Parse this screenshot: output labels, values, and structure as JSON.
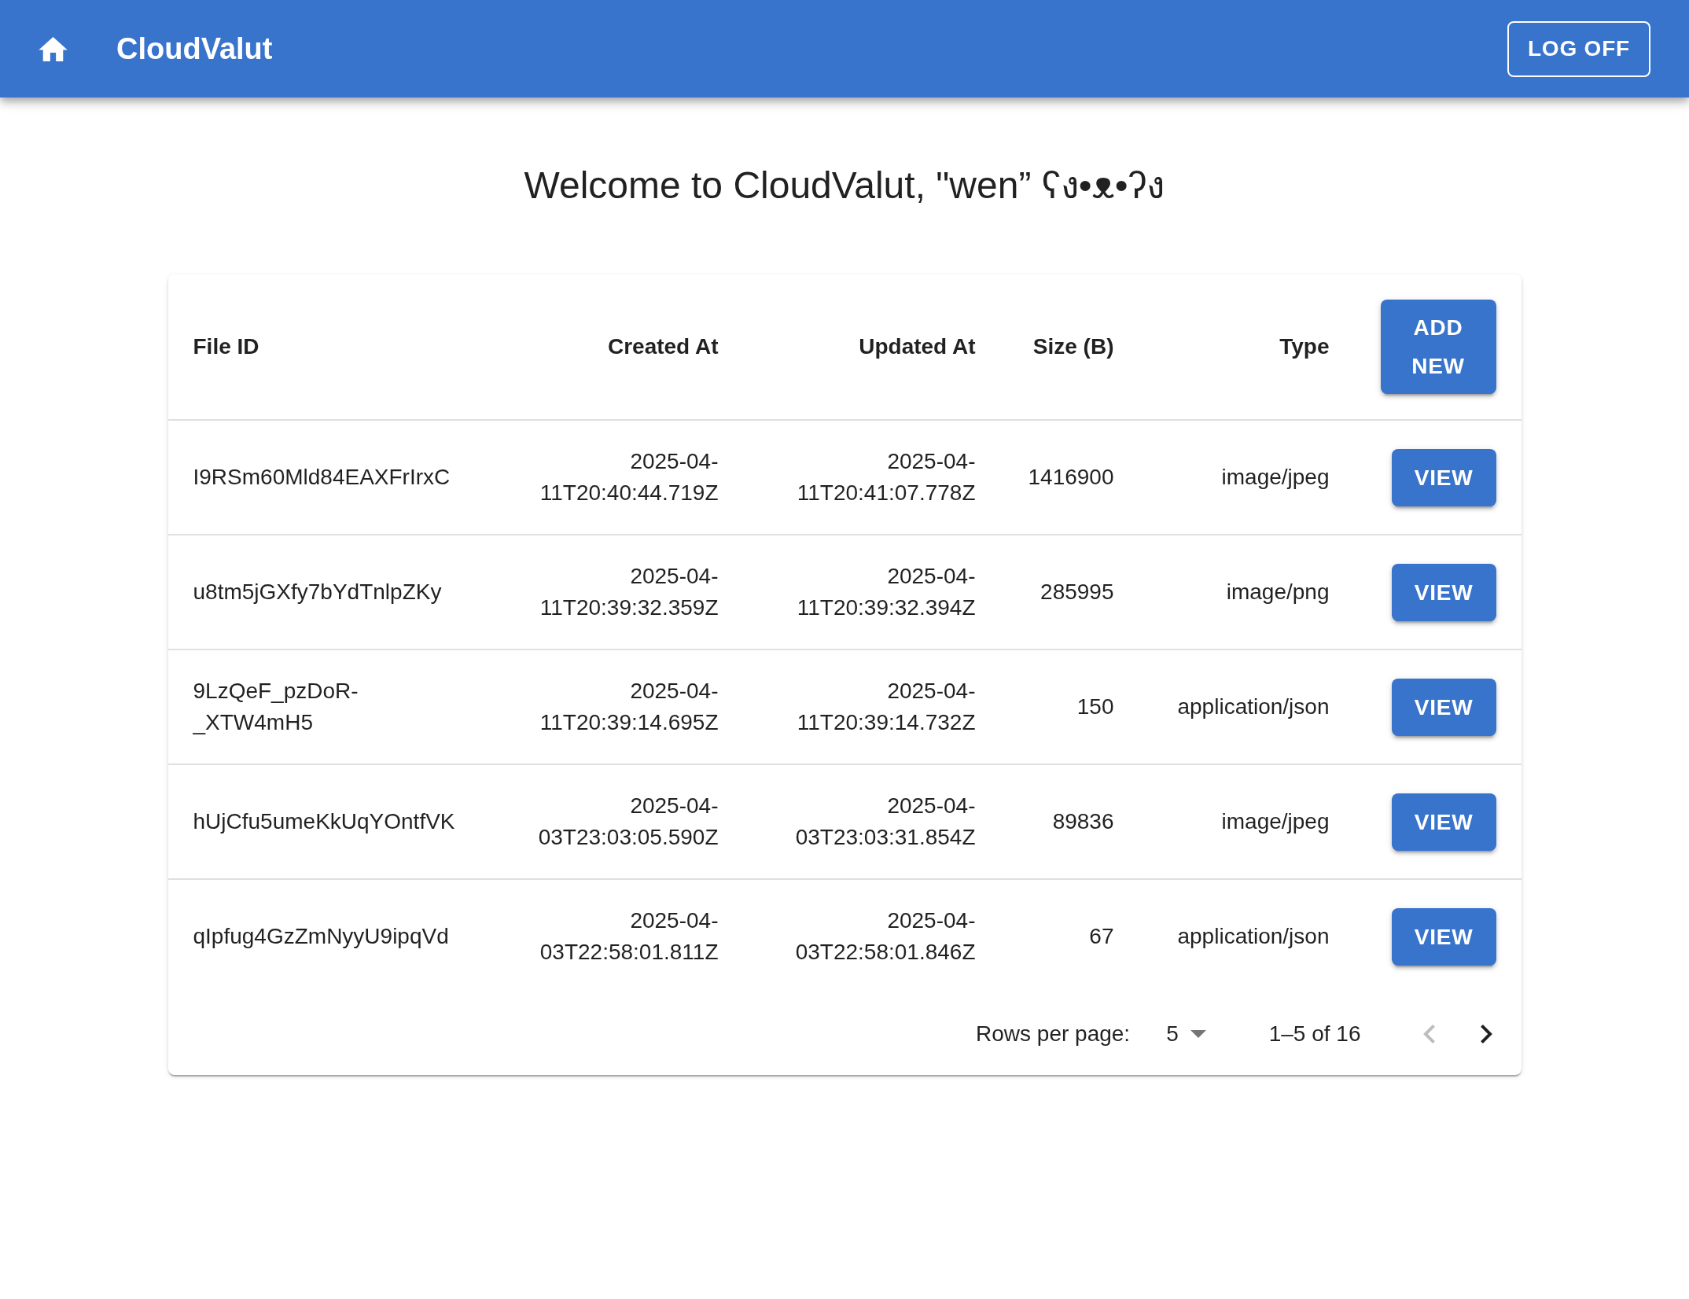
{
  "app_bar": {
    "title": "CloudValut",
    "logout_button": "LOG OFF"
  },
  "heading": "Welcome to CloudValut, \"wen” ʕง•ᴥ•ʔง",
  "table": {
    "columns": [
      "File ID",
      "Created At",
      "Updated At",
      "Size (B)",
      "Type"
    ],
    "add_button": "ADD NEW",
    "rows": [
      {
        "file_id": "I9RSm60Mld84EAXFrIrxC",
        "created_at": "2025-04-11T20:40:44.719Z",
        "updated_at": "2025-04-11T20:41:07.778Z",
        "size": "1416900",
        "type": "image/jpeg",
        "action": "VIEW"
      },
      {
        "file_id": "u8tm5jGXfy7bYdTnlpZKy",
        "created_at": "2025-04-11T20:39:32.359Z",
        "updated_at": "2025-04-11T20:39:32.394Z",
        "size": "285995",
        "type": "image/png",
        "action": "VIEW"
      },
      {
        "file_id": "9LzQeF_pzDoR-_XTW4mH5",
        "created_at": "2025-04-11T20:39:14.695Z",
        "updated_at": "2025-04-11T20:39:14.732Z",
        "size": "150",
        "type": "application/json",
        "action": "VIEW"
      },
      {
        "file_id": "hUjCfu5umeKkUqYOntfVK",
        "created_at": "2025-04-03T23:03:05.590Z",
        "updated_at": "2025-04-03T23:03:31.854Z",
        "size": "89836",
        "type": "image/jpeg",
        "action": "VIEW"
      },
      {
        "file_id": "qIpfug4GzZmNyyU9ipqVd",
        "created_at": "2025-04-03T22:58:01.811Z",
        "updated_at": "2025-04-03T22:58:01.846Z",
        "size": "67",
        "type": "application/json",
        "action": "VIEW"
      }
    ]
  },
  "pagination": {
    "rows_per_page_label": "Rows per page:",
    "rows_per_page": "5",
    "range": "1–5 of 16",
    "page_buttons": [
      {
        "kind": "previous",
        "disabled": true
      },
      {
        "kind": "next",
        "disabled": false
      }
    ]
  }
}
